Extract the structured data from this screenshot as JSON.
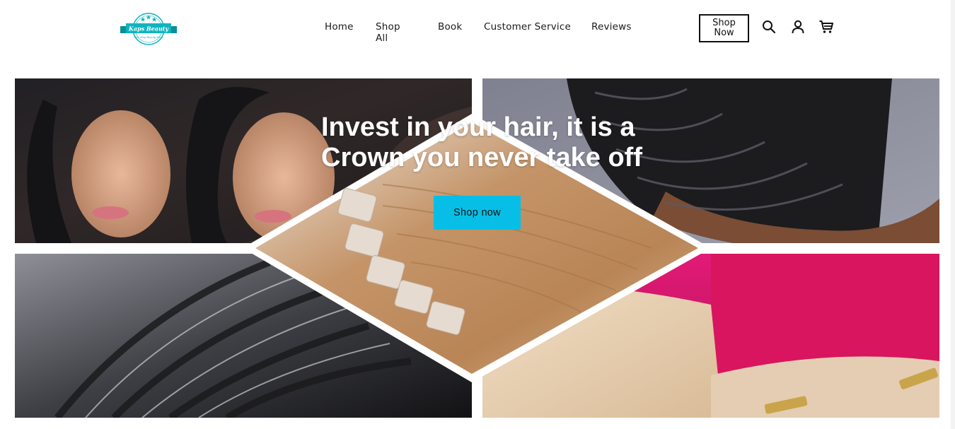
{
  "brand": {
    "name": "Kaps Beauty",
    "tagline": "One Stop Beauty Shop",
    "colors": {
      "primary": "#0fb4bf",
      "accent": "#07bfe6"
    }
  },
  "nav": {
    "items": [
      {
        "label": "Home"
      },
      {
        "label": "Shop All"
      },
      {
        "label": "Book"
      },
      {
        "label": "Customer Service"
      },
      {
        "label": "Reviews"
      }
    ]
  },
  "header_actions": {
    "shop_now_line1": "Shop",
    "shop_now_line2": "Now",
    "icons": [
      "search-icon",
      "account-icon",
      "cart-icon"
    ]
  },
  "hero": {
    "title_line1": "Invest in your hair, it is a",
    "title_line2": "Crown you never take off",
    "cta_label": "Shop now"
  }
}
